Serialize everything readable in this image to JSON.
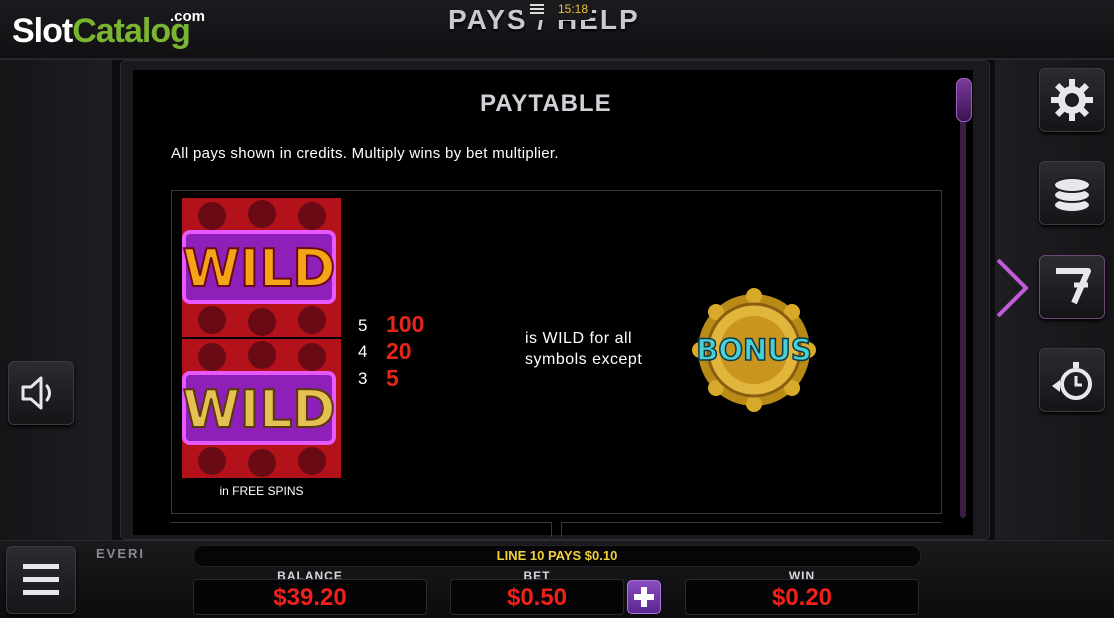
{
  "watermark": {
    "brand_first": "Slot",
    "brand_second": "Catalog",
    "suffix": ".com"
  },
  "header": {
    "title": "PAYS / HELP",
    "time": "15:18"
  },
  "paytable": {
    "title": "PAYTABLE",
    "note": "All pays shown in credits. Multiply wins by bet multiplier.",
    "wild_symbol_text": "WILD",
    "free_spins_label": "in FREE SPINS",
    "pays": [
      {
        "count": "5",
        "amount": "100"
      },
      {
        "count": "4",
        "amount": "20"
      },
      {
        "count": "3",
        "amount": "5"
      }
    ],
    "wild_desc_line1": "is WILD for all",
    "wild_desc_line2": "symbols except",
    "bonus_symbol_text": "BONUS"
  },
  "side_buttons": {
    "left": [
      {
        "icon": "speaker-icon"
      }
    ],
    "right": [
      {
        "icon": "gear-icon"
      },
      {
        "icon": "coin-stack-icon"
      },
      {
        "icon": "seven-icon"
      },
      {
        "icon": "stopwatch-icon"
      }
    ]
  },
  "footer": {
    "brand": "EVERI",
    "line_pays": "LINE 10 PAYS $0.10",
    "balance_label": "BALANCE",
    "balance_value": "$39.20",
    "bet_label": "BET",
    "bet_value": "$0.50",
    "win_label": "WIN",
    "win_value": "$0.20"
  },
  "colors": {
    "accent_purple": "#7a3a9a",
    "meter_red": "#f0201a",
    "line_pays_yellow": "#f2d13b",
    "brand_green": "#7ab531"
  }
}
